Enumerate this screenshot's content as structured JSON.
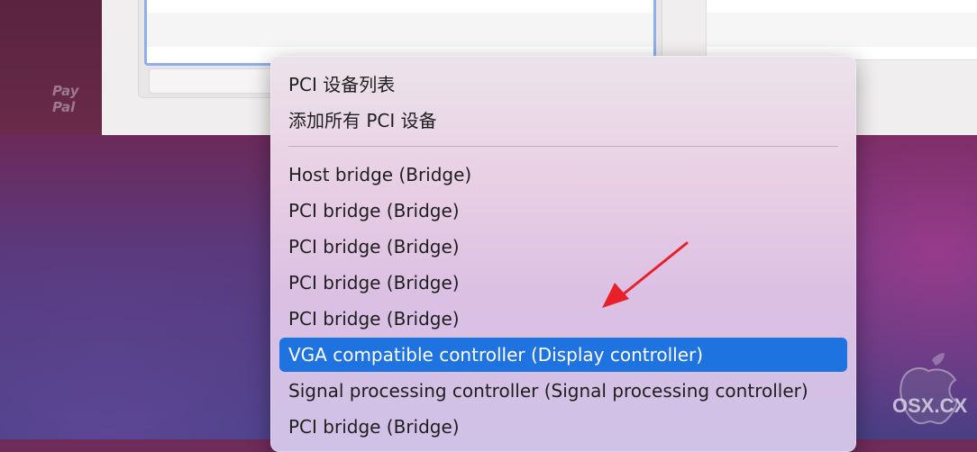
{
  "sidebar": {
    "paypal_line1": "Pay",
    "paypal_line2": "Pal"
  },
  "menu": {
    "header_items": [
      "PCI 设备列表",
      "添加所有 PCI 设备"
    ],
    "device_items": [
      "Host bridge (Bridge)",
      "PCI bridge (Bridge)",
      "PCI bridge (Bridge)",
      "PCI bridge (Bridge)",
      "PCI bridge (Bridge)",
      "VGA compatible controller (Display controller)",
      "Signal processing controller (Signal processing controller)",
      "PCI bridge (Bridge)"
    ],
    "selected_index": 5,
    "selected_color": "#1f73e0"
  },
  "annotation": {
    "arrow_color": "#e8202a"
  },
  "watermark": {
    "text": "OSX.CX"
  }
}
